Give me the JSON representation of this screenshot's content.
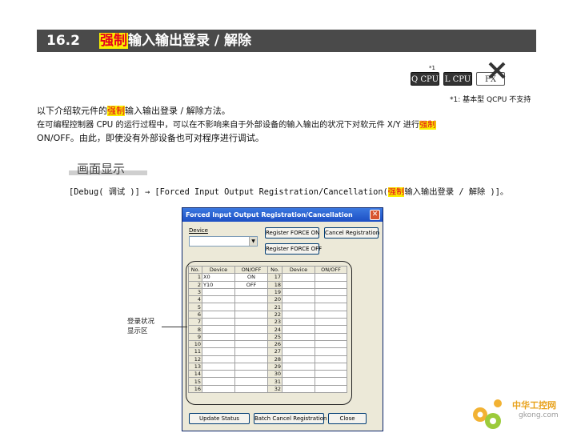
{
  "header": {
    "num": "16.2",
    "hl": "强制",
    "rest": "输入输出登录 / 解除"
  },
  "badges": {
    "q_cpu": "Q CPU",
    "l_cpu": "L CPU",
    "fx": "FX",
    "mark": "*1"
  },
  "footnote": "*1: 基本型 QCPU 不支持",
  "intro": {
    "l1_a": "以下介绍软元件的",
    "l1_hl": "强制",
    "l1_b": "输入输出登录 / 解除方法。",
    "l2_a": "在可编程控制器 CPU 的运行过程中，可以在不影响来自于外部设备的输入输出的状况下对软元件 X/Y 进行",
    "l2_hl": "强制",
    "l3": "ON/OFF。由此，即使没有外部设备也可对程序进行调试。"
  },
  "section_title": "画面显示",
  "menu_path": {
    "a": "[Debug( 调试 )] → [Forced Input Output Registration/Cancellation(",
    "hl": "强制",
    "b": "输入输出登录 / 解除 )]。"
  },
  "dialog": {
    "title": "Forced Input Output Registration/Cancellation",
    "device_label": "Device",
    "device_value": "",
    "btn_register_on": "Register FORCE ON",
    "btn_cancel_reg": "Cancel Registration",
    "btn_register_off": "Register FORCE OFF",
    "columns": [
      "No.",
      "Device",
      "ON/OFF",
      "No.",
      "Device",
      "ON/OFF"
    ],
    "rows": [
      {
        "no_l": "1",
        "dev_l": "X0",
        "st_l": "ON",
        "no_r": "17",
        "dev_r": "",
        "st_r": ""
      },
      {
        "no_l": "2",
        "dev_l": "Y10",
        "st_l": "OFF",
        "no_r": "18",
        "dev_r": "",
        "st_r": ""
      },
      {
        "no_l": "3",
        "dev_l": "",
        "st_l": "",
        "no_r": "19",
        "dev_r": "",
        "st_r": ""
      },
      {
        "no_l": "4",
        "dev_l": "",
        "st_l": "",
        "no_r": "20",
        "dev_r": "",
        "st_r": ""
      },
      {
        "no_l": "5",
        "dev_l": "",
        "st_l": "",
        "no_r": "21",
        "dev_r": "",
        "st_r": ""
      },
      {
        "no_l": "6",
        "dev_l": "",
        "st_l": "",
        "no_r": "22",
        "dev_r": "",
        "st_r": ""
      },
      {
        "no_l": "7",
        "dev_l": "",
        "st_l": "",
        "no_r": "23",
        "dev_r": "",
        "st_r": ""
      },
      {
        "no_l": "8",
        "dev_l": "",
        "st_l": "",
        "no_r": "24",
        "dev_r": "",
        "st_r": ""
      },
      {
        "no_l": "9",
        "dev_l": "",
        "st_l": "",
        "no_r": "25",
        "dev_r": "",
        "st_r": ""
      },
      {
        "no_l": "10",
        "dev_l": "",
        "st_l": "",
        "no_r": "26",
        "dev_r": "",
        "st_r": ""
      },
      {
        "no_l": "11",
        "dev_l": "",
        "st_l": "",
        "no_r": "27",
        "dev_r": "",
        "st_r": ""
      },
      {
        "no_l": "12",
        "dev_l": "",
        "st_l": "",
        "no_r": "28",
        "dev_r": "",
        "st_r": ""
      },
      {
        "no_l": "13",
        "dev_l": "",
        "st_l": "",
        "no_r": "29",
        "dev_r": "",
        "st_r": ""
      },
      {
        "no_l": "14",
        "dev_l": "",
        "st_l": "",
        "no_r": "30",
        "dev_r": "",
        "st_r": ""
      },
      {
        "no_l": "15",
        "dev_l": "",
        "st_l": "",
        "no_r": "31",
        "dev_r": "",
        "st_r": ""
      },
      {
        "no_l": "16",
        "dev_l": "",
        "st_l": "",
        "no_r": "32",
        "dev_r": "",
        "st_r": ""
      }
    ],
    "btn_update": "Update Status",
    "btn_batch_cancel": "Batch Cancel Registration",
    "btn_close": "Close"
  },
  "callout": {
    "l1": "登录状况",
    "l2": "显示区"
  },
  "logo": {
    "cn": "中华工控网",
    "url": "gkong.com"
  },
  "colors": {
    "highlight_bg": "#f8f000",
    "highlight_fg": "#e5001f",
    "header_bg": "#4a4a4a"
  }
}
